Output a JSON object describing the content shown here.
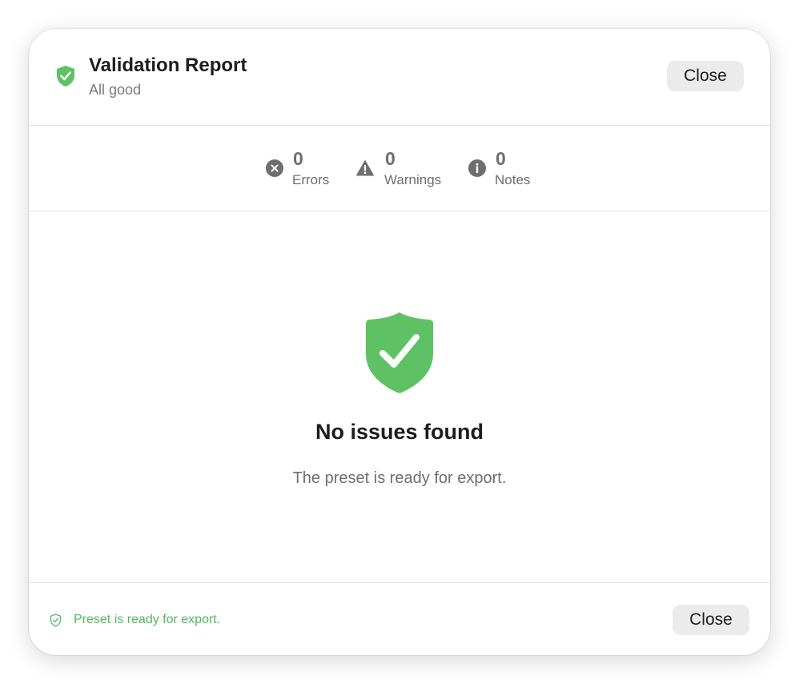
{
  "colors": {
    "success": "#5ec264",
    "success_text": "#4fb85c",
    "muted": "#6e6e6e",
    "button_bg": "#ebebeb"
  },
  "header": {
    "icon": "shield-check-icon",
    "title": "Validation Report",
    "subtitle": "All good",
    "close_label": "Close"
  },
  "summary": {
    "errors": {
      "icon": "error-circle-icon",
      "value": "0",
      "label": "Errors"
    },
    "warnings": {
      "icon": "warning-triangle-icon",
      "value": "0",
      "label": "Warnings"
    },
    "notes": {
      "icon": "info-circle-icon",
      "value": "0",
      "label": "Notes"
    }
  },
  "main": {
    "icon": "shield-check-icon",
    "title": "No issues found",
    "message": "The preset is ready for export."
  },
  "footer": {
    "status_icon": "shield-check-outline-icon",
    "status_text": "Preset is ready for export.",
    "close_label": "Close"
  }
}
